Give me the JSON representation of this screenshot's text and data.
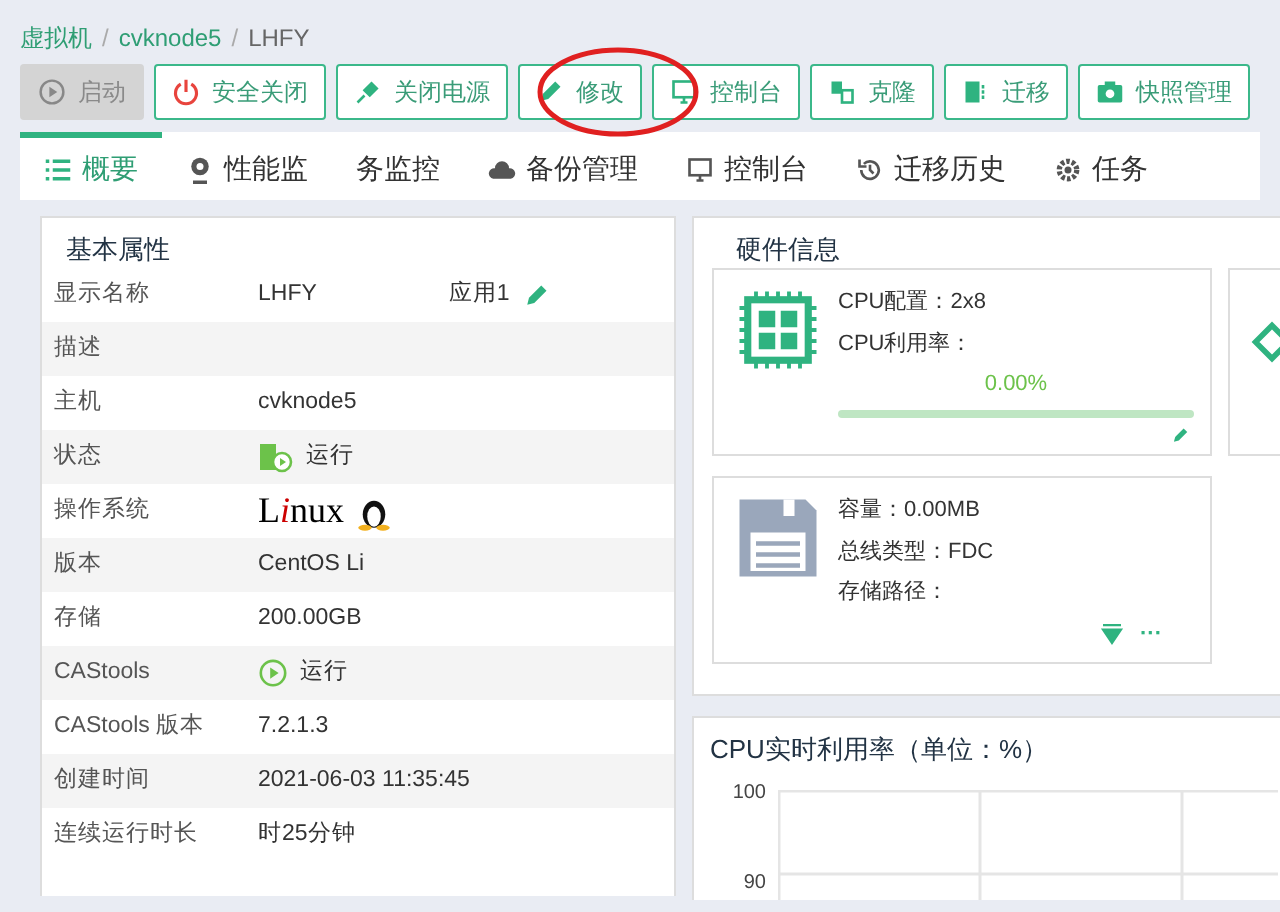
{
  "breadcrumb": [
    "虚拟机",
    "cvknode5",
    "LHFY"
  ],
  "breadcrumb_separator": "/",
  "toolbar": [
    {
      "label": "启动",
      "kind": "start",
      "disabled": true
    },
    {
      "label": "安全关闭",
      "kind": "shutdown",
      "disabled": false
    },
    {
      "label": "关闭电源",
      "kind": "power",
      "disabled": false
    },
    {
      "label": "修改",
      "kind": "edit",
      "disabled": false
    },
    {
      "label": "控制台",
      "kind": "console",
      "disabled": false
    },
    {
      "label": "克隆",
      "kind": "clone",
      "disabled": false
    },
    {
      "label": "迁移",
      "kind": "migrate",
      "disabled": false
    },
    {
      "label": "快照管理",
      "kind": "snapshot",
      "disabled": false
    }
  ],
  "tabs": [
    {
      "label": "概要",
      "kind": "list",
      "selected": true
    },
    {
      "label": "性能监",
      "kind": "gauge",
      "selected": false
    },
    {
      "label": "务监控",
      "kind": "none",
      "selected": false
    },
    {
      "label": "备份管理",
      "kind": "cloud",
      "selected": false
    },
    {
      "label": "控制台",
      "kind": "console",
      "selected": false
    },
    {
      "label": "迁移历史",
      "kind": "history",
      "selected": false
    },
    {
      "label": "任务",
      "kind": "gear",
      "selected": false
    }
  ],
  "basic": {
    "title": "基本属性",
    "rows": [
      {
        "label": "显示名称",
        "kind": "name",
        "values": [
          "LHFY",
          "应用1"
        ]
      },
      {
        "label": "描述",
        "kind": "text",
        "values": []
      },
      {
        "label": "主机",
        "kind": "text",
        "values": [
          "cvknode5"
        ]
      },
      {
        "label": "状态",
        "kind": "status",
        "values": [
          "运行"
        ]
      },
      {
        "label": "操作系统",
        "kind": "os",
        "values": [
          "Linux"
        ]
      },
      {
        "label": "版本",
        "kind": "text",
        "values": [
          "CentOS Li"
        ]
      },
      {
        "label": "存储",
        "kind": "text",
        "values": [
          "200.00GB"
        ]
      },
      {
        "label": "CAStools",
        "kind": "run",
        "values": [
          "运行"
        ]
      },
      {
        "label": "CAStools 版本",
        "kind": "text",
        "values": [
          "7.2.1.3"
        ]
      },
      {
        "label": "创建时间",
        "kind": "text",
        "values": [
          "2021-06-03 11:35:45"
        ]
      },
      {
        "label": "连续运行时长",
        "kind": "text",
        "values": [
          "时25分钟"
        ]
      }
    ]
  },
  "hardware": {
    "title": "硬件信息",
    "cpu": {
      "config": "CPU配置：2x8",
      "usage_label": "CPU利用率：",
      "reading": "0.00%",
      "level": 0
    },
    "disk": {
      "lines": [
        "容量：0.00MB",
        "总线类型：FDC",
        "存储路径："
      ],
      "more": "···"
    }
  },
  "cpu_chart": {
    "title": "CPU实时利用率（单位：%）",
    "y_labels": [
      "100",
      "90"
    ]
  }
}
